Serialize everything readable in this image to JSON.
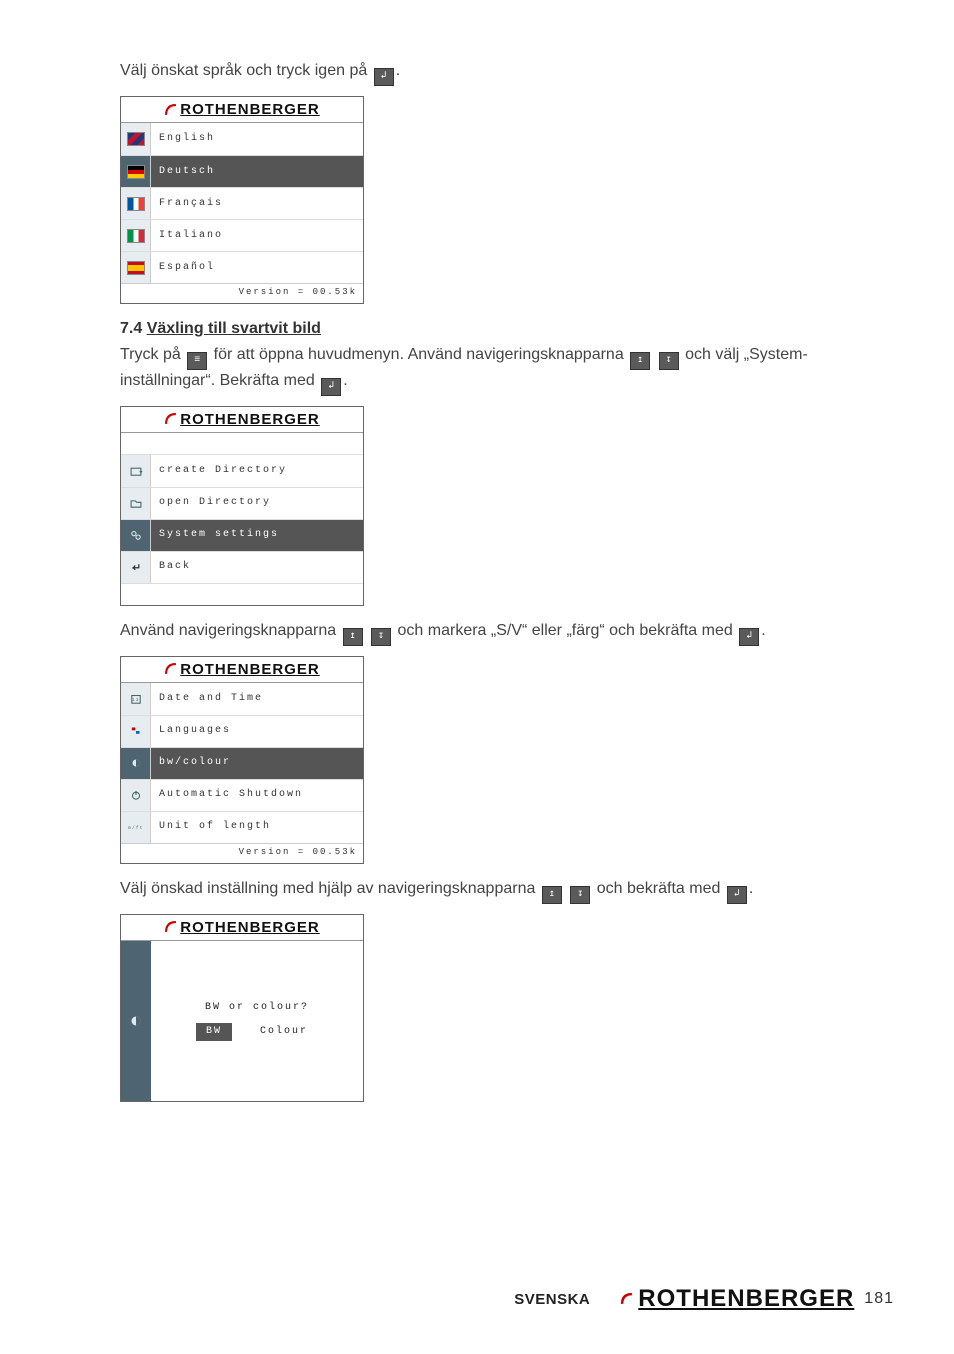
{
  "brand": "ROTHENBERGER",
  "intro_line": "Välj önskat språk och tryck igen på ",
  "intro_tail": ".",
  "lang_panel": {
    "items": [
      {
        "label": "English",
        "flag": "uk",
        "sel": false
      },
      {
        "label": "Deutsch",
        "flag": "de",
        "sel": true
      },
      {
        "label": "Français",
        "flag": "fr",
        "sel": false
      },
      {
        "label": "Italiano",
        "flag": "it",
        "sel": false
      },
      {
        "label": "Español",
        "flag": "es",
        "sel": false
      }
    ],
    "version": "Version = 00.53k"
  },
  "sec74_num": "7.4 ",
  "sec74_title": "Växling till svartvit bild",
  "para2a": "Tryck på ",
  "para2b": " för att öppna huvudmenyn. Använd navigeringsknapparna ",
  "para2c": " och välj „System-inställningar“. Bekräfta med ",
  "para2d": ".",
  "menu_panel": {
    "items": [
      {
        "label": "create Directory",
        "icon": "folder-plus",
        "sel": false
      },
      {
        "label": "open Directory",
        "icon": "folder-open",
        "sel": false
      },
      {
        "label": "System settings",
        "icon": "gears",
        "sel": true
      },
      {
        "label": "Back",
        "icon": "return",
        "sel": false
      }
    ]
  },
  "para3a": "Använd navigeringsknapparna ",
  "para3b": " och markera „S/V“ eller „färg“ och bekräfta med ",
  "para3c": ".",
  "settings_panel": {
    "items": [
      {
        "label": "Date and Time",
        "icon": "calendar",
        "sel": false
      },
      {
        "label": "Languages",
        "icon": "globe",
        "sel": false
      },
      {
        "label": "bw/colour",
        "icon": "contrast",
        "sel": true
      },
      {
        "label": "Automatic Shutdown",
        "icon": "power",
        "sel": false
      },
      {
        "label": "Unit of length",
        "icon": "ruler",
        "sel": false
      }
    ],
    "version": "Version = 00.53k"
  },
  "para4a": "Välj önskad inställning med hjälp av navigeringsknapparna ",
  "para4b": " och bekräfta med ",
  "para4c": ".",
  "bw_panel": {
    "question": "BW or colour?",
    "opt_bw": "BW",
    "opt_colour": "Colour"
  },
  "footer_lang": "SVENSKA",
  "page_number": "181"
}
